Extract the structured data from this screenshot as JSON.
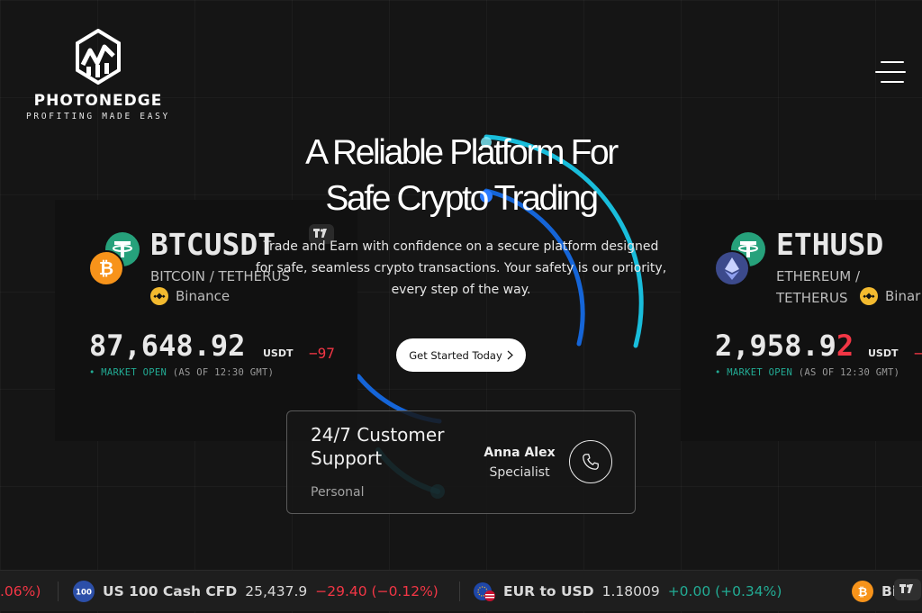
{
  "brand": {
    "name": "PHOTONEDGE",
    "tagline": "PROFITING MADE EASY"
  },
  "hero": {
    "title_line1": "A Reliable Platform For",
    "title_line2": "Safe Crypto Trading",
    "subtitle": "Trade and Earn with confidence on a secure platform designed for safe, seamless crypto transactions. Your safety is our priority, every step of the way.",
    "cta_label": "Get Started Today",
    "cta_icon": "chevron-right-icon"
  },
  "tickers": [
    {
      "symbol": "BTCUSDT",
      "description": "BITCOIN / TETHERUS",
      "exchange": "Binance",
      "price": "87,648.92",
      "unit": "USDT",
      "change": "−97",
      "market_status": "MARKET OPEN",
      "as_of": "(AS OF 12:30 GMT)",
      "base_icon": "bitcoin-icon",
      "quote_icon": "tether-icon"
    },
    {
      "symbol": "ETHUSD",
      "description_line1": "ETHEREUM /",
      "description_line2": "TETHERUS",
      "exchange": "Binar",
      "price_main": "2,958.9",
      "price_highlight": "2",
      "unit": "USDT",
      "change": "−",
      "market_status": "MARKET OPEN",
      "as_of": "(AS OF 12:30 GMT)",
      "base_icon": "ethereum-icon",
      "quote_icon": "tether-icon"
    }
  ],
  "support": {
    "title": "24/7 Customer Support",
    "tag": "Personal",
    "agent_name": "Anna Alex",
    "agent_role": "Specialist",
    "call_icon": "phone-icon"
  },
  "ticker_tape": [
    {
      "change": ".06%)"
    },
    {
      "badge": "100",
      "name": "US 100 Cash CFD",
      "value": "25,437.9",
      "change": "−29.40 (−0.12%)",
      "direction": "down"
    },
    {
      "name": "EUR to USD",
      "value": "1.18009",
      "change": "+0.00 (+0.34%)",
      "direction": "up"
    },
    {
      "name": "Bi"
    }
  ],
  "colors": {
    "background": "#151515",
    "card": "#111111",
    "negative": "#f23645",
    "positive": "#22ab94",
    "tether": "#26a17b",
    "bitcoin": "#f7931a",
    "binance": "#f3ba2f",
    "arc_cyan": "#19c6e6",
    "arc_blue": "#1565d8"
  }
}
